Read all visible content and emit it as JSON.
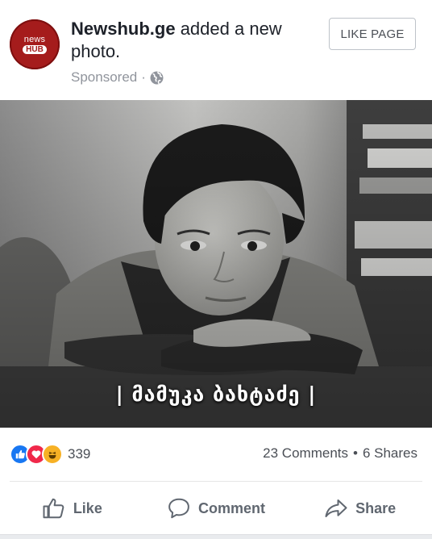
{
  "post": {
    "page_name": "Newshub.ge",
    "action_text": " added a new photo.",
    "sponsored": "Sponsored",
    "meta_separator": "·",
    "like_page_button": "LIKE PAGE",
    "avatar": {
      "top": "news",
      "bottom": "HUB"
    },
    "photo_caption": "| მამუკა ბახტაძე |"
  },
  "stats": {
    "reaction_count": "339",
    "reactions": [
      "like-icon",
      "love-icon",
      "haha-icon"
    ],
    "comments": "23 Comments",
    "separator": "•",
    "shares": "6 Shares"
  },
  "actions": {
    "like": "Like",
    "comment": "Comment",
    "share": "Share"
  },
  "colors": {
    "brand_red": "#a51c1c",
    "like_blue": "#1877f2",
    "love_red": "#f0284a",
    "haha_yellow": "#f7b125"
  }
}
